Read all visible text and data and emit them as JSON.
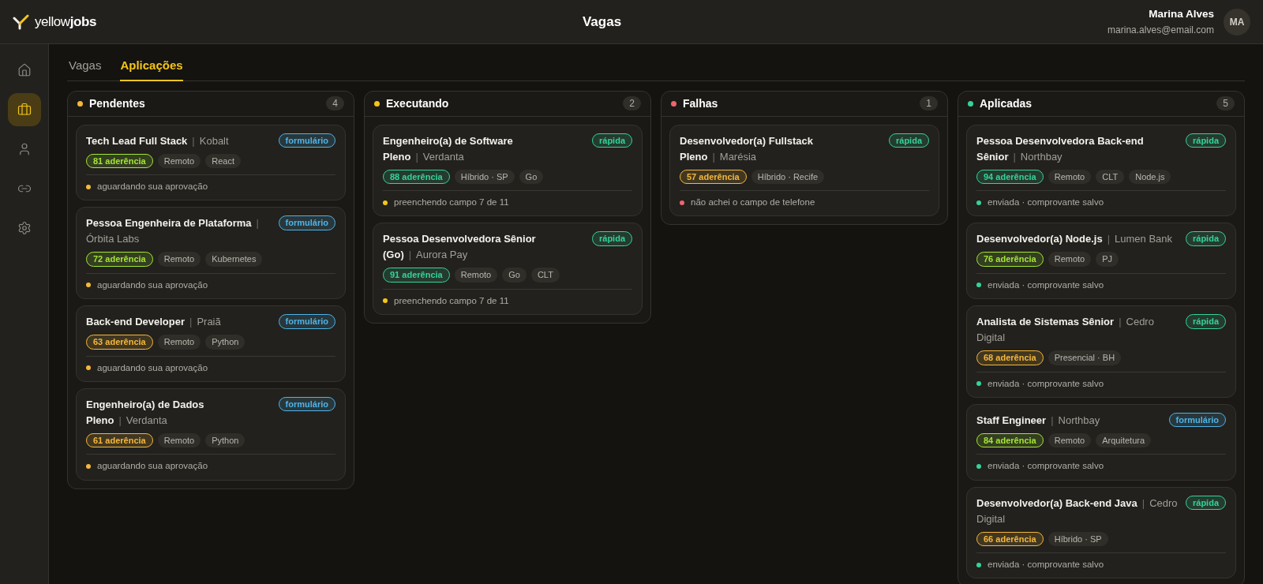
{
  "brand": {
    "name_light": "yellow",
    "name_bold": "jobs"
  },
  "header": {
    "title": "Vagas",
    "user_name": "Marina Alves",
    "user_email": "marina.alves@email.com",
    "avatar_initials": "MA"
  },
  "sidebar": {
    "items": [
      {
        "selected": false
      },
      {
        "selected": true
      },
      {
        "selected": false
      },
      {
        "selected": false
      },
      {
        "selected": false
      }
    ]
  },
  "tabs": [
    {
      "label": "Vagas",
      "selected": false
    },
    {
      "label": "Aplicações",
      "selected": true
    }
  ],
  "columns": [
    {
      "title": "Pendentes",
      "count": "4",
      "color": "#f5b73b",
      "cards": [
        {
          "role": "Tech Lead Full Stack",
          "separator": "|",
          "company": "Kobalt",
          "badge": {
            "label": "formulário",
            "color": "#4fb3e8"
          },
          "score": {
            "value": "81",
            "label": "aderência",
            "color": "#a3e635"
          },
          "tags": [
            "Remoto",
            "React"
          ],
          "status": "aguardando sua aprovação"
        },
        {
          "role": "Pessoa Engenheira de Plataforma",
          "separator": "|",
          "company": "Órbita Labs",
          "badge": {
            "label": "formulário",
            "color": "#4fb3e8"
          },
          "score": {
            "value": "72",
            "label": "aderência",
            "color": "#a3e635"
          },
          "tags": [
            "Remoto",
            "Kubernetes"
          ],
          "status": "aguardando sua aprovação"
        },
        {
          "role": "Back-end Developer",
          "separator": "|",
          "company": "Praiã",
          "badge": {
            "label": "formulário",
            "color": "#4fb3e8"
          },
          "score": {
            "value": "63",
            "label": "aderência",
            "color": "#f5b73b"
          },
          "tags": [
            "Remoto",
            "Python"
          ],
          "status": "aguardando sua aprovação"
        },
        {
          "role": "Engenheiro(a) de Dados Pleno",
          "separator": "|",
          "company": "Verdanta",
          "badge": {
            "label": "formulário",
            "color": "#4fb3e8"
          },
          "score": {
            "value": "61",
            "label": "aderência",
            "color": "#f5b73b"
          },
          "tags": [
            "Remoto",
            "Python"
          ],
          "status": "aguardando sua aprovação"
        }
      ]
    },
    {
      "title": "Executando",
      "count": "2",
      "color": "#f5c518",
      "cards": [
        {
          "role": "Engenheiro(a) de Software Pleno",
          "separator": "|",
          "company": "Verdanta",
          "badge": {
            "label": "rápida",
            "color": "#34d399"
          },
          "score": {
            "value": "88",
            "label": "aderência",
            "color": "#34d399"
          },
          "tags": [
            "Híbrido · SP",
            "Go"
          ],
          "status": "preenchendo campo 7 de 11"
        },
        {
          "role": "Pessoa Desenvolvedora Sênior (Go)",
          "separator": "|",
          "company": "Aurora Pay",
          "badge": {
            "label": "rápida",
            "color": "#34d399"
          },
          "score": {
            "value": "91",
            "label": "aderência",
            "color": "#34d399"
          },
          "tags": [
            "Remoto",
            "Go",
            "CLT"
          ],
          "status": "preenchendo campo 7 de 11"
        }
      ]
    },
    {
      "title": "Falhas",
      "count": "1",
      "color": "#f0646e",
      "cards": [
        {
          "role": "Desenvolvedor(a) Fullstack Pleno",
          "separator": "|",
          "company": "Marésia",
          "badge": {
            "label": "rápida",
            "color": "#34d399"
          },
          "score": {
            "value": "57",
            "label": "aderência",
            "color": "#f5b73b"
          },
          "tags": [
            "Híbrido · Recife"
          ],
          "status": "não achei o campo de telefone"
        }
      ]
    },
    {
      "title": "Aplicadas",
      "count": "5",
      "color": "#34d399",
      "cards": [
        {
          "role": "Pessoa Desenvolvedora Back-end Sênior",
          "separator": "|",
          "company": "Northbay",
          "badge": {
            "label": "rápida",
            "color": "#34d399"
          },
          "score": {
            "value": "94",
            "label": "aderência",
            "color": "#34d399"
          },
          "tags": [
            "Remoto",
            "CLT",
            "Node.js"
          ],
          "status": "enviada · comprovante salvo"
        },
        {
          "role": "Desenvolvedor(a) Node.js",
          "separator": "|",
          "company": "Lumen Bank",
          "badge": {
            "label": "rápida",
            "color": "#34d399"
          },
          "score": {
            "value": "76",
            "label": "aderência",
            "color": "#a3e635"
          },
          "tags": [
            "Remoto",
            "PJ"
          ],
          "status": "enviada · comprovante salvo"
        },
        {
          "role": "Analista de Sistemas Sênior",
          "separator": "|",
          "company": "Cedro Digital",
          "badge": {
            "label": "rápida",
            "color": "#34d399"
          },
          "score": {
            "value": "68",
            "label": "aderência",
            "color": "#f5b73b"
          },
          "tags": [
            "Presencial · BH"
          ],
          "status": "enviada · comprovante salvo"
        },
        {
          "role": "Staff Engineer",
          "separator": "|",
          "company": "Northbay",
          "badge": {
            "label": "formulário",
            "color": "#4fb3e8"
          },
          "score": {
            "value": "84",
            "label": "aderência",
            "color": "#a3e635"
          },
          "tags": [
            "Remoto",
            "Arquitetura"
          ],
          "status": "enviada · comprovante salvo"
        },
        {
          "role": "Desenvolvedor(a) Back-end Java",
          "separator": "|",
          "company": "Cedro Digital",
          "badge": {
            "label": "rápida",
            "color": "#34d399"
          },
          "score": {
            "value": "66",
            "label": "aderência",
            "color": "#f5b73b"
          },
          "tags": [
            "Híbrido · SP"
          ],
          "status": "enviada · comprovante salvo"
        }
      ]
    }
  ]
}
